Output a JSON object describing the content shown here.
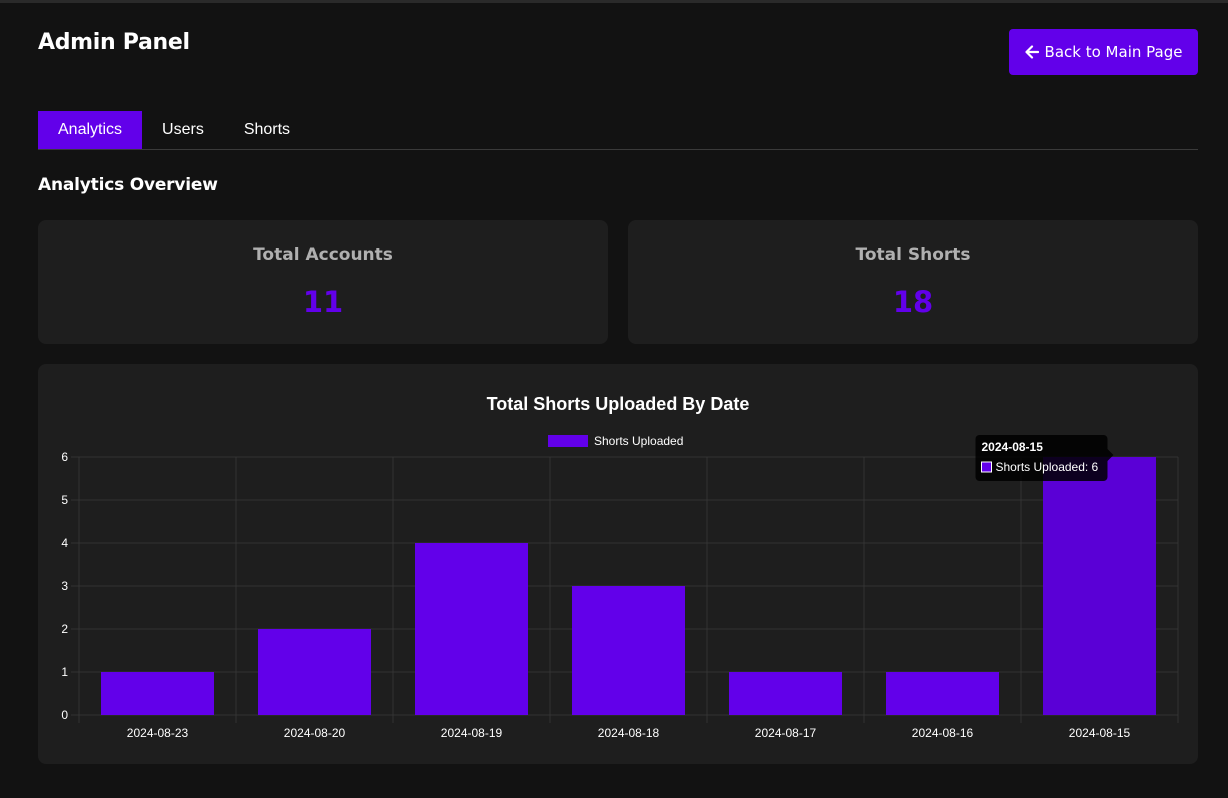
{
  "header": {
    "title": "Admin Panel",
    "back_button": {
      "label": "Back to Main Page",
      "icon": "arrow-left-icon"
    }
  },
  "tabs": [
    {
      "label": "Analytics",
      "active": true
    },
    {
      "label": "Users",
      "active": false
    },
    {
      "label": "Shorts",
      "active": false
    }
  ],
  "analytics": {
    "title": "Analytics Overview",
    "cards": [
      {
        "label": "Total Accounts",
        "value": "11"
      },
      {
        "label": "Total Shorts",
        "value": "18"
      }
    ]
  },
  "colors": {
    "accent": "#6200ea",
    "background": "#121212",
    "card": "#1e1e1e",
    "label": "#b0b0b0"
  },
  "chart_data": {
    "type": "bar",
    "title": "Total Shorts Uploaded By Date",
    "categories": [
      "2024-08-23",
      "2024-08-20",
      "2024-08-19",
      "2024-08-18",
      "2024-08-17",
      "2024-08-16",
      "2024-08-15"
    ],
    "series": [
      {
        "name": "Shorts Uploaded",
        "values": [
          1,
          2,
          4,
          3,
          1,
          1,
          6
        ],
        "color": "#6200ea"
      }
    ],
    "ylim": [
      0,
      6
    ],
    "yticks": [
      0,
      1,
      2,
      3,
      4,
      5,
      6
    ],
    "grid": true,
    "legend": "top-center",
    "tooltip": {
      "title": "2024-08-15",
      "label": "Shorts Uploaded: 6"
    },
    "hovered_index": 6
  }
}
